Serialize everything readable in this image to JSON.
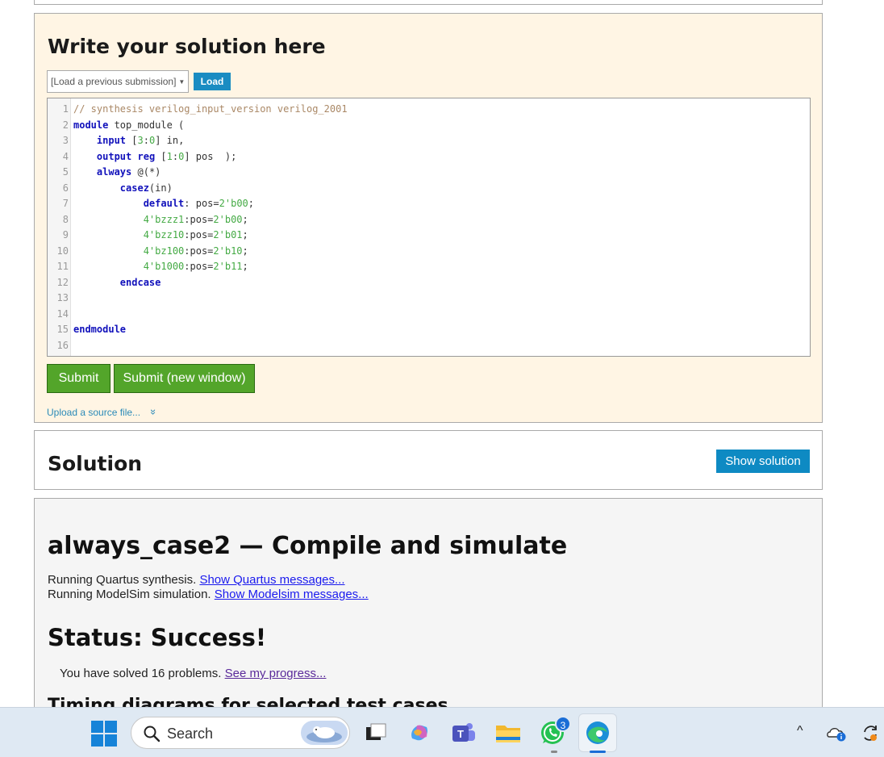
{
  "editor": {
    "title": "Write your solution here",
    "load_select": "[Load a previous submission]",
    "load_button": "Load",
    "code_lines": [
      {
        "n": "1",
        "html": "<span class=\"cmt\">// synthesis verilog_input_version verilog_2001</span>"
      },
      {
        "n": "2",
        "html": "<span class=\"kw\">module</span> top_module ("
      },
      {
        "n": "3",
        "html": "    <span class=\"kw\">input</span> [<span class=\"num\">3</span>:<span class=\"num\">0</span>] in,"
      },
      {
        "n": "4",
        "html": "    <span class=\"kw\">output</span> <span class=\"kw\">reg</span> [<span class=\"num\">1</span>:<span class=\"num\">0</span>] pos  );"
      },
      {
        "n": "5",
        "html": "    <span class=\"kw\">always</span> @(*)"
      },
      {
        "n": "6",
        "html": "        <span class=\"kw\">casez</span>(in)"
      },
      {
        "n": "7",
        "html": "            <span class=\"kw\">default</span>: pos=<span class=\"num\">2'b00</span>;"
      },
      {
        "n": "8",
        "html": "            <span class=\"num\">4'bzzz1</span>:pos=<span class=\"num\">2'b00</span>;"
      },
      {
        "n": "9",
        "html": "            <span class=\"num\">4'bzz10</span>:pos=<span class=\"num\">2'b01</span>;"
      },
      {
        "n": "10",
        "html": "            <span class=\"num\">4'bz100</span>:pos=<span class=\"num\">2'b10</span>;"
      },
      {
        "n": "11",
        "html": "            <span class=\"num\">4'b1000</span>:pos=<span class=\"num\">2'b11</span>;"
      },
      {
        "n": "12",
        "html": "        <span class=\"kw\">endcase</span>"
      },
      {
        "n": "13",
        "html": ""
      },
      {
        "n": "14",
        "html": ""
      },
      {
        "n": "15",
        "html": "<span class=\"kw\">endmodule</span>"
      },
      {
        "n": "16",
        "html": ""
      }
    ],
    "submit": "Submit",
    "submit_new": "Submit (new window)",
    "upload": "Upload a source file...",
    "upload_icon": "»"
  },
  "solution": {
    "title": "Solution",
    "show_button": "Show solution"
  },
  "result": {
    "title": "always_case2 — Compile and simulate",
    "quartus_text": "Running Quartus synthesis.",
    "quartus_link": "Show Quartus messages...",
    "modelsim_text": "Running ModelSim simulation.",
    "modelsim_link": "Show Modelsim messages...",
    "status": "Status: Success!",
    "progress_text": "You have solved 16 problems.",
    "progress_link": "See my progress...",
    "timing_heading": "Timing diagrams for selected test cases"
  },
  "taskbar": {
    "search_label": "Search",
    "whatsapp_badge": "3",
    "tray_up": "^",
    "accent": "#1683d8"
  }
}
